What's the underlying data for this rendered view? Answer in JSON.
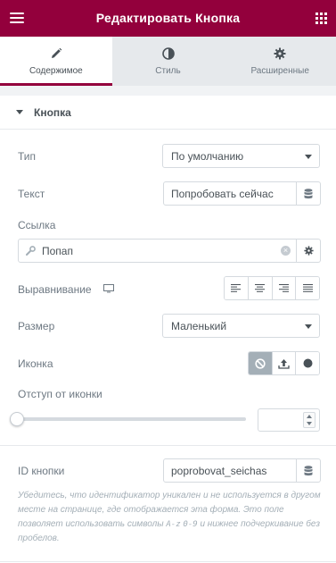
{
  "header": {
    "title": "Редактировать Кнопка",
    "menu_icon": "hamburger-menu-icon",
    "apps_icon": "grid-apps-icon",
    "bg_color": "#93003c"
  },
  "tabs": [
    {
      "label": "Содержимое",
      "icon": "pencil-icon",
      "active": true
    },
    {
      "label": "Стиль",
      "icon": "contrast-circle-icon",
      "active": false
    },
    {
      "label": "Расширенные",
      "icon": "gear-icon",
      "active": false
    }
  ],
  "section": {
    "title": "Кнопка",
    "expanded": true
  },
  "fields": {
    "type": {
      "label": "Тип",
      "value": "По умолчанию"
    },
    "text": {
      "label": "Текст",
      "value": "Попробовать сейчас",
      "dynamic_icon": "database-icon"
    },
    "link": {
      "label": "Ссылка",
      "value": "Попап",
      "prefix_icon": "wrench-icon",
      "clear_icon": "clear-x-icon",
      "settings_icon": "gear-icon"
    },
    "align": {
      "label": "Выравнивание",
      "device_icon": "desktop-icon",
      "options": [
        "align-left",
        "align-center",
        "align-right",
        "align-justify"
      ]
    },
    "size": {
      "label": "Размер",
      "value": "Маленький"
    },
    "icon": {
      "label": "Иконка",
      "options": [
        "none",
        "upload",
        "circle"
      ],
      "active": "none"
    },
    "icon_spacing": {
      "label": "Отступ от иконки",
      "value": "",
      "slider_fraction": 0
    },
    "button_id": {
      "label": "ID кнопки",
      "value": "poprobovat_seichas"
    }
  },
  "help": {
    "text_part1": "Убедитесь, что идентификатор уникален и не используется в другом месте на странице, где отображается эта форма. Это поле позволяет использовать символы ",
    "code1": "A-z",
    "code2": "0-9",
    "text_part2": " и нижнее подчеркивание без пробелов."
  }
}
